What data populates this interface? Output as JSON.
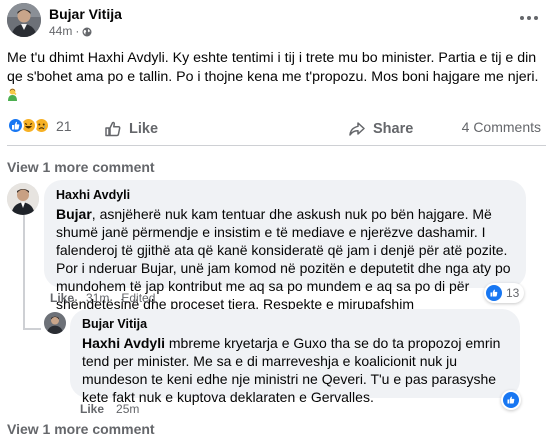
{
  "post": {
    "author": "Bujar Vitija",
    "time": "44m",
    "dot": "·",
    "text": "Me t'u dhimt Haxhi Avdyli. Ky eshte tentimi i tij i trete mu bo minister. Partia e tij e din qe s'bohet ama po e tallin. Po i thojne kena me t'propozu. Mos boni hajgare me njeri.",
    "reaction_count": "21",
    "comments_label": "4 Comments",
    "like_label": "Like",
    "share_label": "Share",
    "icons": [
      "globe-icon",
      "more-icon",
      "man-facepalming-emoji",
      "like-reaction",
      "haha-reaction",
      "sad-reaction",
      "thumbs-up-icon",
      "share-arrow-icon"
    ]
  },
  "view_more_top": "View 1 more comment",
  "view_more_bottom": "View 1 more comment",
  "comment1": {
    "author": "Haxhi Avdyli",
    "mention": "Bujar",
    "text": ", asnjëherë nuk kam tentuar dhe askush nuk po bën hajgare. Më shumë janë përmendje e insistim e të mediave e njerëzve dashamir. I falenderoj të gjithë ata që kanë konsideratë që jam i denjë për atë pozite. Por i nderuar Bujar, unë jam komod në pozitën e deputetit dhe nga aty po mundohem të jap kontribut me aq sa po mundem e aq sa po di për shëndetësinë dhe proceset tjera. Respekte e mirupafshim",
    "like_label": "Like",
    "time": "31m",
    "edited": "Edited",
    "reaction_count": "13"
  },
  "reply1": {
    "author": "Bujar Vitija",
    "mention": "Haxhi Avdyli",
    "text": " mbreme kryetarja e Guxo tha se do ta propozoj emrin tend per minister. Me sa e di marreveshja e koalicionit nuk ju mundeson te keni edhe nje ministri ne Qeveri. T'u e pas parasyshe kete fakt nuk e kuptova deklaraten e Gervalles.",
    "like_label": "Like",
    "time": "25m"
  },
  "colors": {
    "primary_text": "#050505",
    "secondary_text": "#65676b",
    "bubble": "#f0f2f5",
    "like_blue": "#1877f2",
    "divider": "#ced0d4"
  }
}
